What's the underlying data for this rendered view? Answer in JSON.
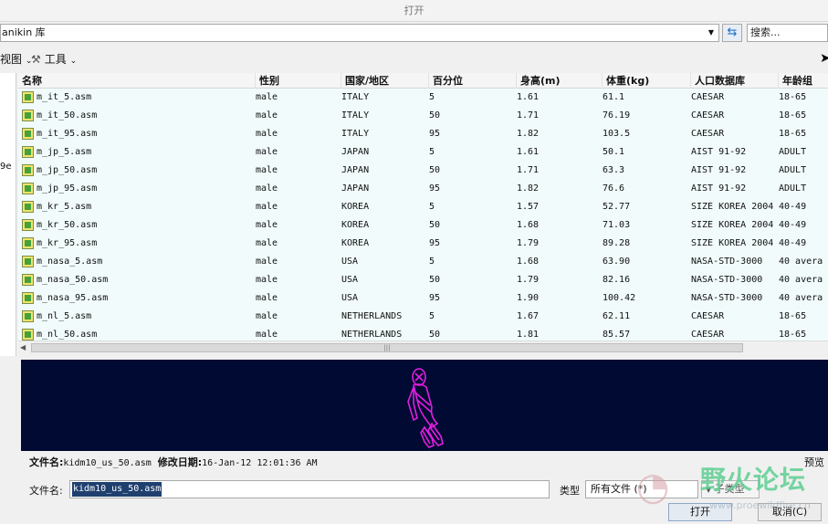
{
  "window": {
    "title": "打开"
  },
  "path": {
    "value": "anikin 库"
  },
  "search": {
    "placeholder": "搜索..."
  },
  "toolbar": {
    "view_label": "视图",
    "tools_label": "工具"
  },
  "left_pane": {
    "fragment": "9e"
  },
  "columns": [
    "名称",
    "性别",
    "国家/地区",
    "百分位",
    "身高(m)",
    "体重(kg)",
    "人口数据库",
    "年龄组"
  ],
  "rows": [
    [
      "m_it_5.asm",
      "male",
      "ITALY",
      "5",
      "1.61",
      "61.1",
      "CAESAR",
      "18-65"
    ],
    [
      "m_it_50.asm",
      "male",
      "ITALY",
      "50",
      "1.71",
      "76.19",
      "CAESAR",
      "18-65"
    ],
    [
      "m_it_95.asm",
      "male",
      "ITALY",
      "95",
      "1.82",
      "103.5",
      "CAESAR",
      "18-65"
    ],
    [
      "m_jp_5.asm",
      "male",
      "JAPAN",
      "5",
      "1.61",
      "50.1",
      "AIST 91-92",
      "ADULT"
    ],
    [
      "m_jp_50.asm",
      "male",
      "JAPAN",
      "50",
      "1.71",
      "63.3",
      "AIST 91-92",
      "ADULT"
    ],
    [
      "m_jp_95.asm",
      "male",
      "JAPAN",
      "95",
      "1.82",
      "76.6",
      "AIST 91-92",
      "ADULT"
    ],
    [
      "m_kr_5.asm",
      "male",
      "KOREA",
      "5",
      "1.57",
      "52.77",
      "SIZE KOREA 2004",
      "40-49"
    ],
    [
      "m_kr_50.asm",
      "male",
      "KOREA",
      "50",
      "1.68",
      "71.03",
      "SIZE KOREA 2004",
      "40-49"
    ],
    [
      "m_kr_95.asm",
      "male",
      "KOREA",
      "95",
      "1.79",
      "89.28",
      "SIZE KOREA 2004",
      "40-49"
    ],
    [
      "m_nasa_5.asm",
      "male",
      "USA",
      "5",
      "1.68",
      "63.90",
      "NASA-STD-3000",
      "40 avera"
    ],
    [
      "m_nasa_50.asm",
      "male",
      "USA",
      "50",
      "1.79",
      "82.16",
      "NASA-STD-3000",
      "40 avera"
    ],
    [
      "m_nasa_95.asm",
      "male",
      "USA",
      "95",
      "1.90",
      "100.42",
      "NASA-STD-3000",
      "40 avera"
    ],
    [
      "m_nl_5.asm",
      "male",
      "NETHERLANDS",
      "5",
      "1.67",
      "62.11",
      "CAESAR",
      "18-65"
    ],
    [
      "m_nl_50.asm",
      "male",
      "NETHERLANDS",
      "50",
      "1.81",
      "85.57",
      "CAESAR",
      "18-65"
    ]
  ],
  "info": {
    "filename_label": "文件名:",
    "filename_value": "kidm10_us_50.asm",
    "modified_label": "修改日期:",
    "modified_value": "16-Jan-12 12:01:36 AM",
    "preview_label": "预览"
  },
  "bottom": {
    "filename_label": "文件名:",
    "filename_value": "kidm10_us_50.asm",
    "type_label": "类型",
    "type_value": "所有文件 (*)",
    "subtype_label": "子类型",
    "open_label": "打开",
    "cancel_label": "取消(C)"
  },
  "watermark": {
    "text": "野火论坛",
    "url": "www.proewildfire.cn"
  },
  "colors": {
    "row_bg": "#f1fbfb",
    "preview_bg": "#000a33",
    "model": "#e01ee0",
    "accent": "#1d6fc0"
  },
  "icons": [
    "chevron-down-icon",
    "refresh-icon",
    "wrench-icon",
    "assembly-file-icon",
    "mouse-cursor-icon"
  ]
}
